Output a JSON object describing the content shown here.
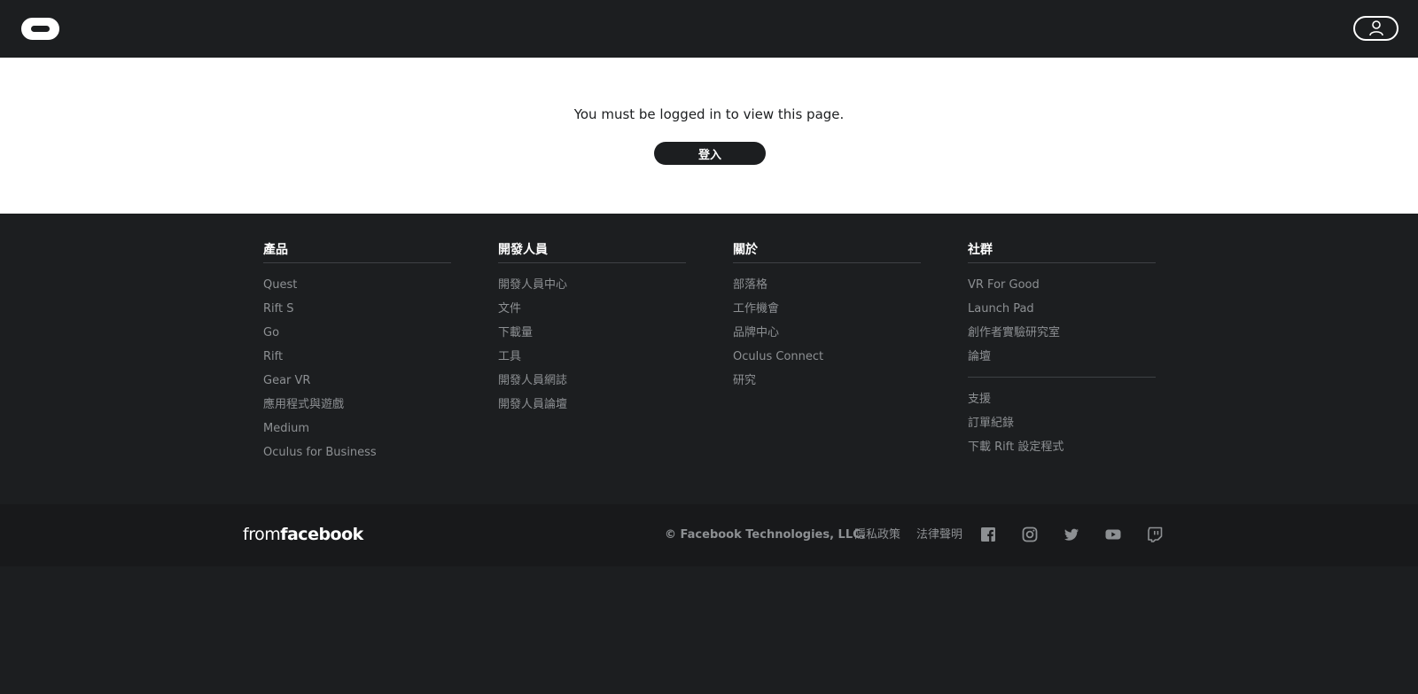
{
  "header": {
    "logo_icon": "oculus-logo-icon",
    "account_icon": "user-icon"
  },
  "main": {
    "message": "You must be logged in to view this page.",
    "login_label": "登入"
  },
  "footer": {
    "columns": [
      {
        "title": "產品",
        "items": [
          "Quest",
          "Rift S",
          "Go",
          "Rift",
          "Gear VR",
          "應用程式與遊戲",
          "Medium",
          "Oculus for Business"
        ]
      },
      {
        "title": "開發人員",
        "items": [
          "開發人員中心",
          "文件",
          "下載量",
          "工具",
          "開發人員網誌",
          "開發人員論壇"
        ]
      },
      {
        "title": "關於",
        "items": [
          "部落格",
          "工作機會",
          "品牌中心",
          "Oculus Connect",
          "研究"
        ]
      },
      {
        "title": "社群",
        "items": [
          "VR For Good",
          "Launch Pad",
          "創作者實驗研究室",
          "論壇"
        ],
        "extra_items": [
          "支援",
          "訂單紀錄",
          "下載 Rift 設定程式"
        ]
      }
    ]
  },
  "bottom": {
    "from": "from",
    "brand": "facebook",
    "copyright": "©  Facebook Technologies, LLC.",
    "privacy": "隱私政策",
    "legal": "法律聲明",
    "social_icons": [
      "facebook-icon",
      "instagram-icon",
      "twitter-icon",
      "youtube-icon",
      "twitch-icon"
    ]
  },
  "colors": {
    "dark": "#1c1e20",
    "footer_link": "#8d9093",
    "white": "#ffffff"
  }
}
